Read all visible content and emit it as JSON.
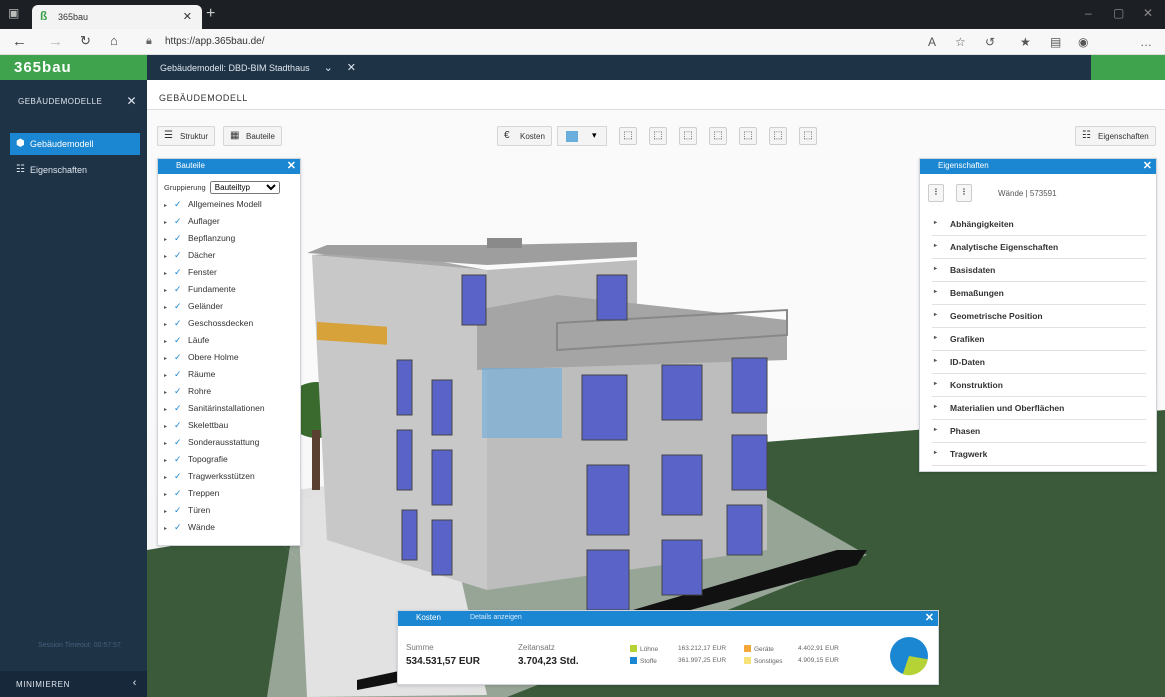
{
  "browser": {
    "tab_title": "365bau",
    "url": "https://app.365bau.de/"
  },
  "app": {
    "brand": "365bau",
    "model_tab": "Gebäudemodell: DBD-BIM Stadthaus",
    "sidebar": {
      "header": "Gebäudemodelle",
      "items": [
        {
          "label": "Gebäudemodell",
          "icon": "building-icon",
          "active": true
        },
        {
          "label": "Eigenschaften",
          "icon": "list-icon",
          "active": false
        }
      ],
      "session": "Session Timeout: 00:57:57",
      "minimize": "Minimieren"
    },
    "main_title": "Gebäudemodell",
    "toolbar": {
      "struktur": "Struktur",
      "bauteile": "Bauteile",
      "kosten": "Kosten",
      "eigenschaften": "Eigenschaften",
      "accent_color": "#6aaede"
    }
  },
  "bauteile_panel": {
    "title": "Bauteile",
    "gruppierung_label": "Gruppierung",
    "gruppierung_value": "Bauteiltyp",
    "items": [
      "Allgemeines Modell",
      "Auflager",
      "Bepflanzung",
      "Dächer",
      "Fenster",
      "Fundamente",
      "Geländer",
      "Geschossdecken",
      "Läufe",
      "Obere Holme",
      "Räume",
      "Rohre",
      "Sanitärinstallationen",
      "Skelettbau",
      "Sonderausstattung",
      "Topografie",
      "Tragwerksstützen",
      "Treppen",
      "Türen",
      "Wände"
    ]
  },
  "eigenschaften_panel": {
    "title": "Eigenschaften",
    "selection": "Wände | 573591",
    "sections": [
      "Abhängigkeiten",
      "Analytische Eigenschaften",
      "Basisdaten",
      "Bemaßungen",
      "Geometrische Position",
      "Grafiken",
      "ID-Daten",
      "Konstruktion",
      "Materialien und Oberflächen",
      "Phasen",
      "Tragwerk"
    ]
  },
  "kosten_panel": {
    "title": "Kosten",
    "details_link": "Details anzeigen",
    "summe_label": "Summe",
    "summe_value": "534.531,57 EUR",
    "zeitansatz_label": "Zeitansatz",
    "zeitansatz_value": "3.704,23 Std.",
    "legend": [
      {
        "label": "Löhne",
        "value": "163.212,17 EUR",
        "color": "#b5d334"
      },
      {
        "label": "Stoffe",
        "value": "361.997,25 EUR",
        "color": "#1b87d2"
      },
      {
        "label": "Geräte",
        "value": "4.402,91 EUR",
        "color": "#f4a83a"
      },
      {
        "label": "Sonstiges",
        "value": "4.909,15 EUR",
        "color": "#f7e27a"
      }
    ]
  }
}
